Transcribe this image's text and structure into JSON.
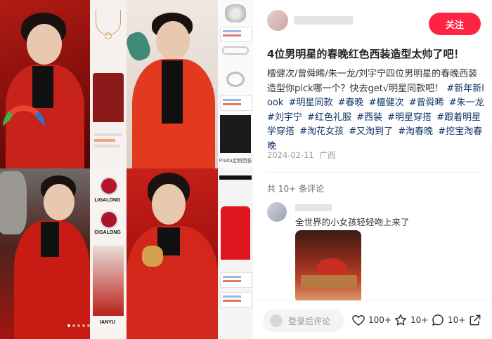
{
  "gallery": {
    "captions": {
      "brand_1": "LIGALONG",
      "brand_2": "CIGALONG",
      "brand_3": "IANYU",
      "prada": "Prada定制西装"
    },
    "slide_count": 12,
    "active_slide": 1
  },
  "note": {
    "follow_label": "关注",
    "title": "4位男明星的春晚红色西装造型太帅了吧！",
    "body": "檀健次/曾舜晞/朱一龙/刘宇宁四位男明星的春晚西装造型你pick哪一个？快去get√明星同款吧！",
    "tags": [
      "#新年新look",
      "#明星同款",
      "#春晚",
      "#檀健次",
      "#曾舜晞",
      "#朱一龙",
      "#刘宇宁",
      "#红色礼服",
      "#西装",
      "#明星穿搭",
      "#跟着明星学穿搭",
      "#淘花女孩",
      "#又淘到了",
      "#淘春晚",
      "#挖宝淘春晚"
    ],
    "date": "2024-02-11",
    "location": "广西"
  },
  "comments": {
    "count_label": "共 10+ 条评论",
    "items": [
      {
        "text": "全世界的小女孩轻轻吻上来了"
      }
    ]
  },
  "bottom_bar": {
    "input_placeholder": "登录后评论",
    "likes": "100+",
    "collects": "10+",
    "comments": "10+"
  },
  "colors": {
    "accent": "#ff2442",
    "tag": "#13386c"
  }
}
